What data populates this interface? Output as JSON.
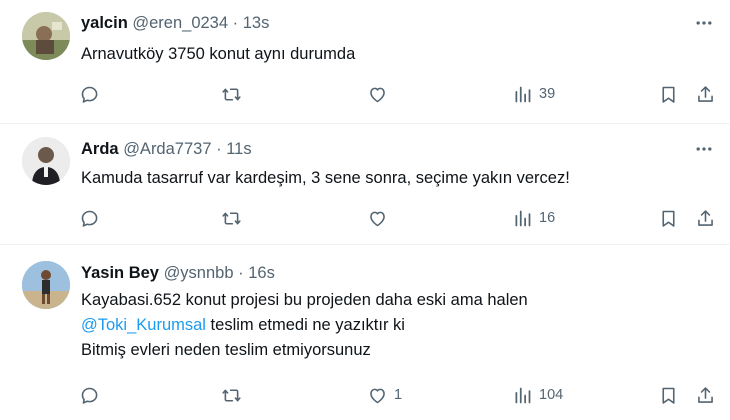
{
  "tweets": [
    {
      "name": "yalcin",
      "handle": "@eren_0234",
      "sep": "·",
      "time": "13s",
      "lines": [
        "Arnavutköy 3750 konut aynı durumda"
      ],
      "views": "39",
      "likes": ""
    },
    {
      "name": "Arda",
      "handle": "@Arda7737",
      "sep": "·",
      "time": "11s",
      "lines": [
        "Kamuda tasarruf var kardeşim, 3 sene sonra, seçime yakın vercez!"
      ],
      "views": "16",
      "likes": ""
    },
    {
      "name": "Yasin Bey",
      "handle": "@ysnnbb",
      "sep": "·",
      "time": "16s",
      "line1": "Kayabasi.652 konut projesi bu projeden daha eski ama halen",
      "mention": "@Toki_Kurumsal",
      "line2_rest": " teslim etmedi ne yazıktır ki",
      "line3": "Bitmiş evleri neden teslim etmiyorsunuz",
      "views": "104",
      "likes": "1"
    }
  ],
  "colors": {
    "text": "#0f1419",
    "muted": "#536471",
    "link": "#1d9bf0",
    "divider": "#eff3f4"
  },
  "icons": [
    "more-icon",
    "reply-icon",
    "retweet-icon",
    "like-icon",
    "views-icon",
    "bookmark-icon",
    "share-icon"
  ]
}
